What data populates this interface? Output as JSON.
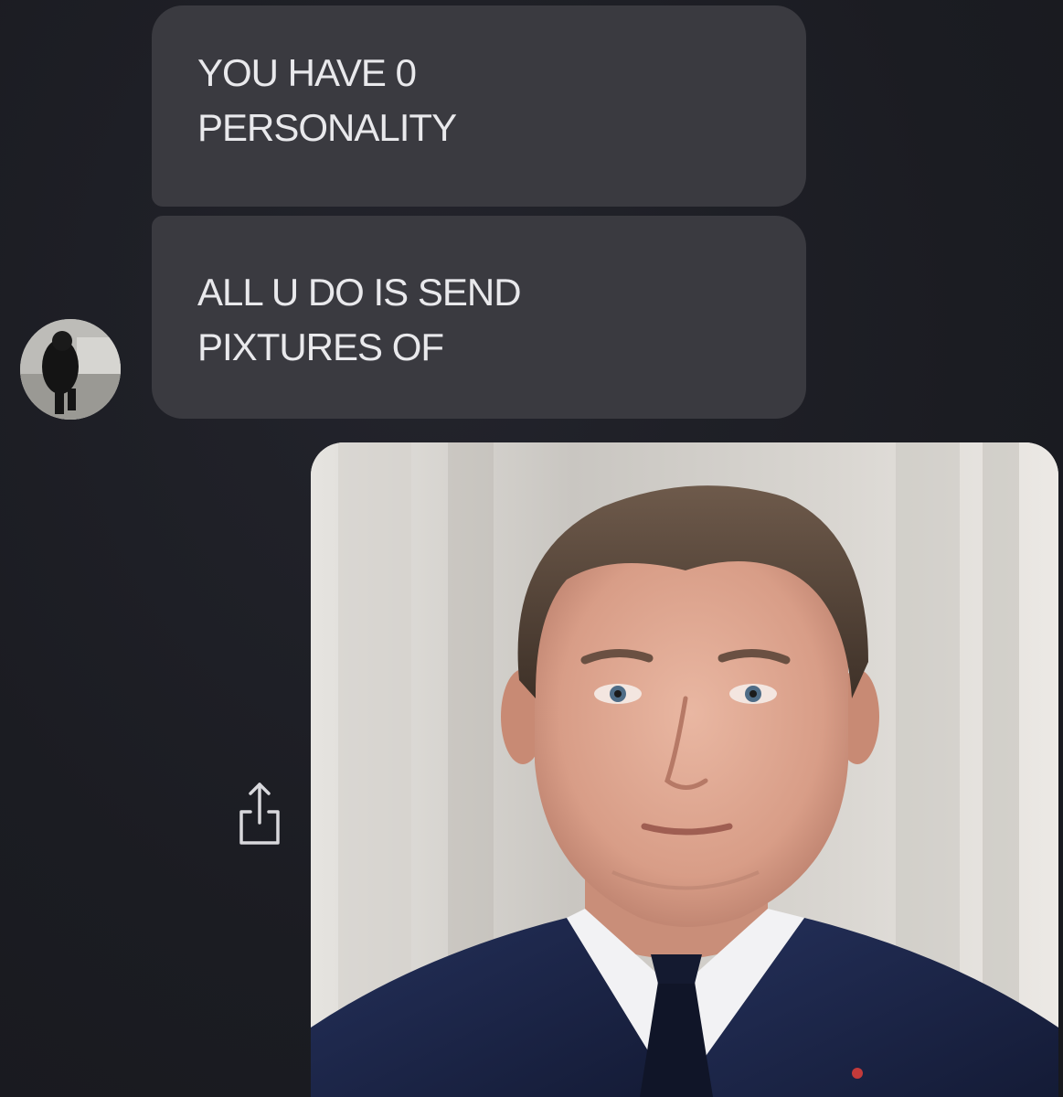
{
  "conversation": {
    "messages": [
      {
        "sender": "other",
        "text": "YOU HAVE 0\nPERSONALITY"
      },
      {
        "sender": "other",
        "text": "ALL U DO IS SEND\nPIXTURES OF"
      }
    ],
    "attachment": {
      "type": "photo",
      "share_icon": "share-icon"
    }
  },
  "colors": {
    "background": "#1c1d24",
    "bubble": "#3a3a40",
    "bubble_text": "#e9e9ec"
  }
}
